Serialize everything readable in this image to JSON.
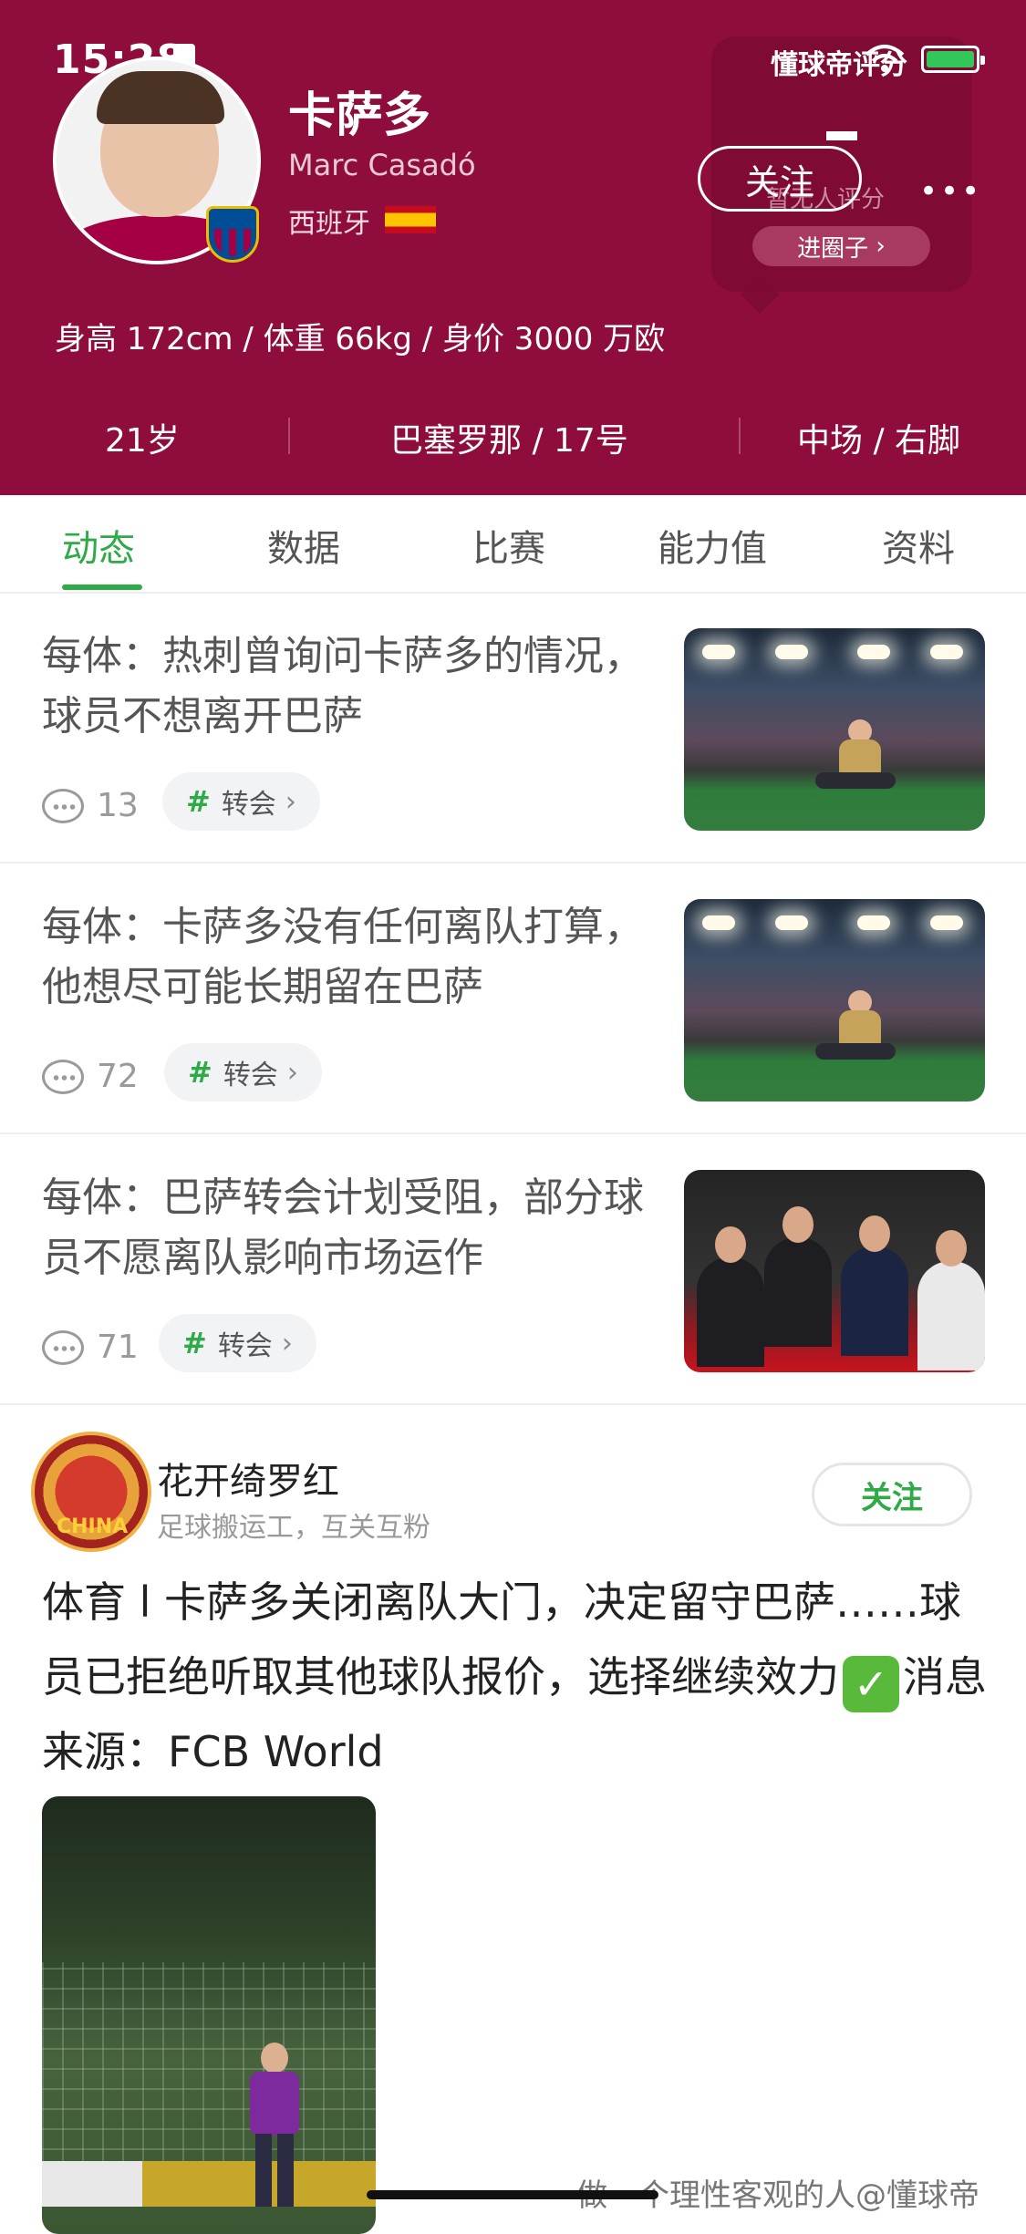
{
  "status_bar": {
    "time": "15:28",
    "app_label": "懂球帝评分"
  },
  "player": {
    "name_cn": "卡萨多",
    "name_en": "Marc Casadó",
    "country": "西班牙",
    "body_stats": "身高 172cm / 体重 66kg / 身价 3000 万欧",
    "age": "21岁",
    "club_number": "巴塞罗那 / 17号",
    "position_foot": "中场 / 右脚"
  },
  "header_actions": {
    "follow_label": "关注",
    "rating_label": "暂无人评分",
    "circle_label": "进圈子"
  },
  "tabs": [
    "动态",
    "数据",
    "比赛",
    "能力值",
    "资料"
  ],
  "articles": [
    {
      "title": "每体：热刺曾询问卡萨多的情况，球员不想离开巴萨",
      "comments": "13",
      "tag": "转会"
    },
    {
      "title": "每体：卡萨多没有任何离队打算，他想尽可能长期留在巴萨",
      "comments": "72",
      "tag": "转会"
    },
    {
      "title": "每体：巴萨转会计划受阻，部分球员不愿离队影响市场运作",
      "comments": "71",
      "tag": "转会"
    }
  ],
  "post": {
    "avatar_badge": "CHINA",
    "username": "花开绮罗红",
    "bio": "足球搬运工，互关互粉",
    "follow_label": "关注",
    "text_before": "体育 l 卡萨多关闭离队大门，决定留守巴萨……球员已拒绝听取其他球队报价，选择继续效力",
    "text_after": "消息来源：FCB World"
  },
  "watermark": "做一个理性客观的人@懂球帝"
}
